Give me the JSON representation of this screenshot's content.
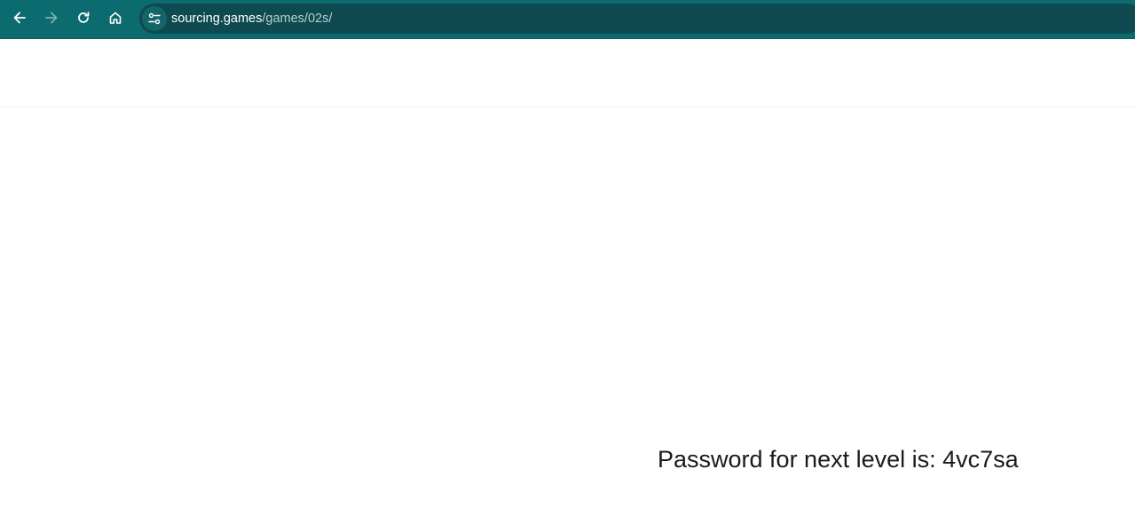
{
  "browser": {
    "url_host": "sourcing.games",
    "url_path": "/games/02s/",
    "colors": {
      "toolbar": "#0b6b6e",
      "omnibox": "#0e4a50",
      "icon": "#ffffff",
      "icon_disabled": "#7fb1b3"
    },
    "icons": {
      "back": "arrow-left-icon",
      "forward": "arrow-right-icon",
      "reload": "reload-icon",
      "home": "home-icon",
      "site_info": "tune-icon"
    }
  },
  "page": {
    "message": "Password for next level is: 4vc7sa"
  }
}
